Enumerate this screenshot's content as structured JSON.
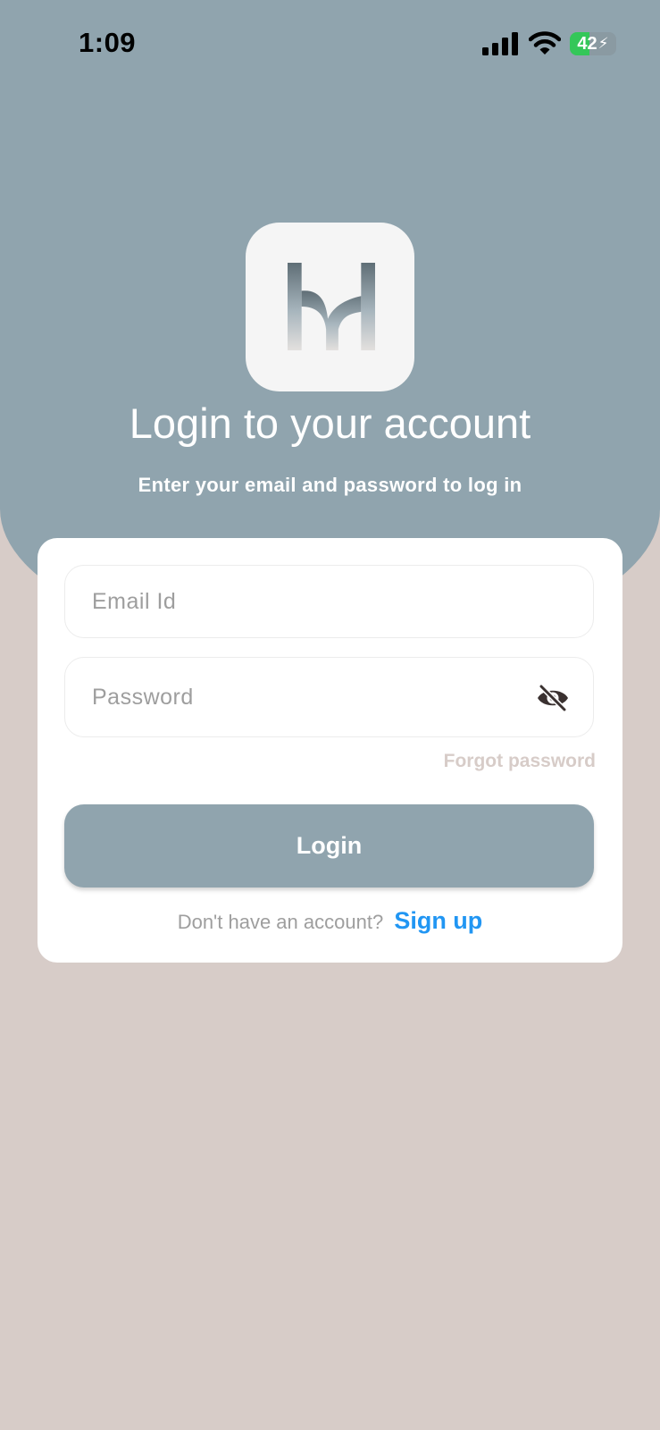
{
  "status_bar": {
    "time": "1:09",
    "battery": "42"
  },
  "colors": {
    "primary": "#90a4ae",
    "background": "#d7ccc8",
    "link": "#2196f3",
    "card": "#ffffff"
  },
  "icons": {
    "signal": "signal-icon",
    "wifi": "wifi-icon",
    "battery": "battery-icon",
    "logo": "app-logo",
    "password_visibility": "eye-off-icon"
  },
  "header": {
    "title": "Login to your account",
    "subtitle": "Enter your email and password to log in"
  },
  "form": {
    "email_placeholder": "Email Id",
    "email_value": "",
    "password_placeholder": "Password",
    "password_value": "",
    "forgot_password": "Forgot password",
    "login_button": "Login",
    "signup_prompt": "Don't have an account?",
    "signup_link": "Sign up"
  }
}
